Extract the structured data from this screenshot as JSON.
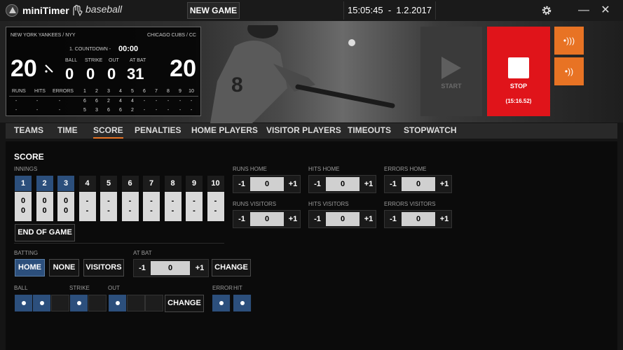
{
  "app": {
    "name": "miniTimer",
    "sport": "baseball",
    "new_game": "NEW GAME",
    "time": "15:05:45",
    "date": "1.2.2017"
  },
  "window_icons": {
    "settings": "gear-icon",
    "minimize": "minimize-icon",
    "close": "close-icon"
  },
  "scoreboard": {
    "home_team": "NEW YORK YANKEES / NYY",
    "visitor_team": "CHICAGO CUBS / CC",
    "period": "1. COUNTDOWN -",
    "countdown": "00:00",
    "home_score": "20",
    "visitor_score": "20",
    "labels": {
      "ball": "BALL",
      "strike": "STRIKE",
      "out": "OUT",
      "at_bat": "AT BAT",
      "runs": "RUNS",
      "hits": "HITS",
      "errors": "ERRORS"
    },
    "ball": "0",
    "strike": "0",
    "out": "0",
    "at_bat": "31",
    "innings": [
      "1",
      "2",
      "3",
      "4",
      "5",
      "6",
      "7",
      "8",
      "9",
      "10"
    ],
    "home_line": [
      "-",
      "-",
      "-",
      "6",
      "6",
      "2",
      "4",
      "4",
      "-",
      "-",
      "-",
      "-",
      "-"
    ],
    "visitor_line": [
      "-",
      "-",
      "-",
      "5",
      "3",
      "6",
      "6",
      "2",
      "-",
      "-",
      "-",
      "-",
      "-"
    ]
  },
  "controls": {
    "start": "START",
    "stop": "STOP",
    "stop_time": "(15:16.52)"
  },
  "tabs": [
    "TEAMS",
    "TIME",
    "SCORE",
    "PENALTIES",
    "HOME PLAYERS",
    "VISITOR PLAYERS",
    "TIMEOUTS",
    "STOPWATCH"
  ],
  "active_tab": "SCORE",
  "score": {
    "title": "SCORE",
    "innings_label": "INNINGS",
    "innings": [
      {
        "n": "1",
        "home": "0",
        "visitor": "0"
      },
      {
        "n": "2",
        "home": "0",
        "visitor": "0"
      },
      {
        "n": "3",
        "home": "0",
        "visitor": "0"
      },
      {
        "n": "4",
        "home": "-",
        "visitor": "-"
      },
      {
        "n": "5",
        "home": "-",
        "visitor": "-"
      },
      {
        "n": "6",
        "home": "-",
        "visitor": "-"
      },
      {
        "n": "7",
        "home": "-",
        "visitor": "-"
      },
      {
        "n": "8",
        "home": "-",
        "visitor": "-"
      },
      {
        "n": "9",
        "home": "-",
        "visitor": "-"
      },
      {
        "n": "10",
        "home": "-",
        "visitor": "-"
      }
    ],
    "end_of_game": "END OF GAME",
    "runs_home": {
      "label": "RUNS HOME",
      "value": "0"
    },
    "hits_home": {
      "label": "HITS HOME",
      "value": "0"
    },
    "errors_home": {
      "label": "ERRORS HOME",
      "value": "0"
    },
    "runs_visitors": {
      "label": "RUNS VISITORS",
      "value": "0"
    },
    "hits_visitors": {
      "label": "HITS VISITORS",
      "value": "0"
    },
    "errors_visitors": {
      "label": "ERRORS VISITORS",
      "value": "0"
    },
    "minus": "-1",
    "plus": "+1",
    "batting_label": "BATTING",
    "home": "HOME",
    "none": "NONE",
    "visitors": "VISITORS",
    "at_bat_label": "AT BAT",
    "at_bat_value": "0",
    "change": "CHANGE",
    "ball_label": "BALL",
    "strike_label": "STRIKE",
    "out_label": "OUT",
    "error_label": "ERROR",
    "hit_label": "HIT"
  },
  "colors": {
    "accent": "#e87324",
    "stop": "#e0141a",
    "selected": "#2c4f7c"
  }
}
